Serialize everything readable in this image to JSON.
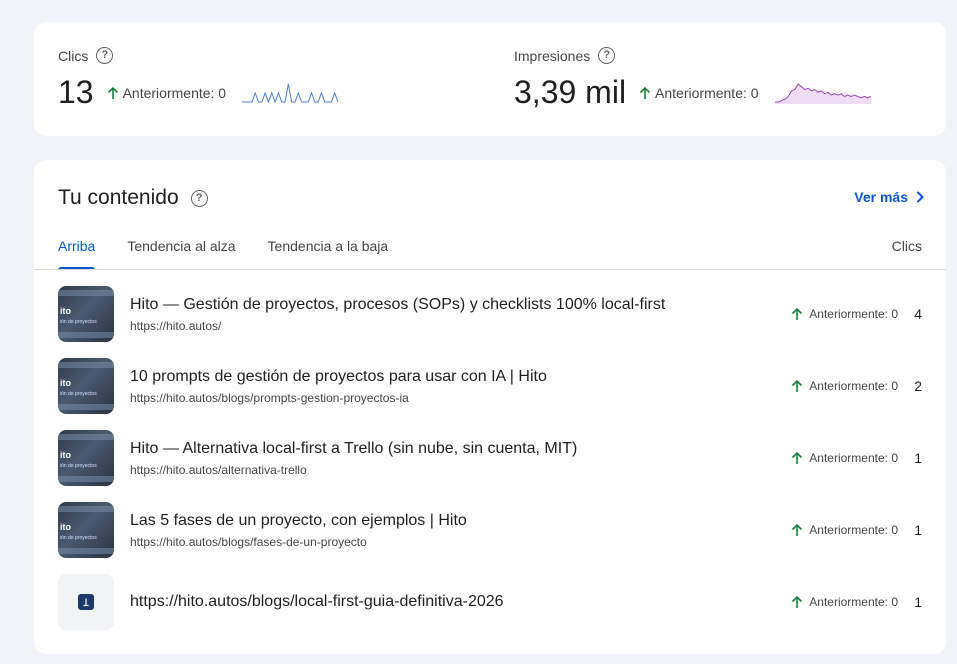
{
  "stats": {
    "clicks": {
      "label": "Clics",
      "value": "13",
      "previous": "Anteriormente: 0",
      "spark_color": "#4a7fd4",
      "spark": [
        0,
        0,
        0,
        0,
        1,
        0,
        0,
        1,
        0,
        1,
        0,
        1,
        0,
        0,
        2,
        0,
        0,
        1,
        0,
        0,
        0,
        1,
        0,
        0,
        1,
        0,
        0,
        0,
        1,
        0
      ]
    },
    "impressions": {
      "label": "Impresiones",
      "value": "3,39 mil",
      "previous": "Anteriormente: 0",
      "spark_color": "#a142c4",
      "spark": [
        0,
        0,
        1,
        2,
        4,
        8,
        9,
        13,
        11,
        9,
        10,
        8,
        9,
        7,
        8,
        6,
        7,
        5,
        6,
        5,
        6,
        4,
        5,
        4,
        5,
        4,
        3,
        4,
        3,
        4
      ]
    }
  },
  "content": {
    "title": "Tu contenido",
    "see_more": "Ver más",
    "tabs": [
      "Arriba",
      "Tendencia al alza",
      "Tendencia a la baja"
    ],
    "column_header": "Clics",
    "thumb_text": "ito",
    "thumb_sub": "ión de proyectos",
    "rows": [
      {
        "title": "Hito — Gestión de proyectos, procesos (SOPs) y checklists 100% local-first",
        "url": "https://hito.autos/",
        "previous": "Anteriormente: 0",
        "value": "4"
      },
      {
        "title": "10 prompts de gestión de proyectos para usar con IA | Hito",
        "url": "https://hito.autos/blogs/prompts-gestion-proyectos-ia",
        "previous": "Anteriormente: 0",
        "value": "2"
      },
      {
        "title": "Hito — Alternativa local-first a Trello (sin nube, sin cuenta, MIT)",
        "url": "https://hito.autos/alternativa-trello",
        "previous": "Anteriormente: 0",
        "value": "1"
      },
      {
        "title": "Las 5 fases de un proyecto, con ejemplos | Hito",
        "url": "https://hito.autos/blogs/fases-de-un-proyecto",
        "previous": "Anteriormente: 0",
        "value": "1"
      },
      {
        "title": "https://hito.autos/blogs/local-first-guia-definitiva-2026",
        "url": "",
        "previous": "Anteriormente: 0",
        "value": "1"
      }
    ]
  },
  "colors": {
    "accent": "#0b57d0",
    "up_arrow": "#188038"
  }
}
